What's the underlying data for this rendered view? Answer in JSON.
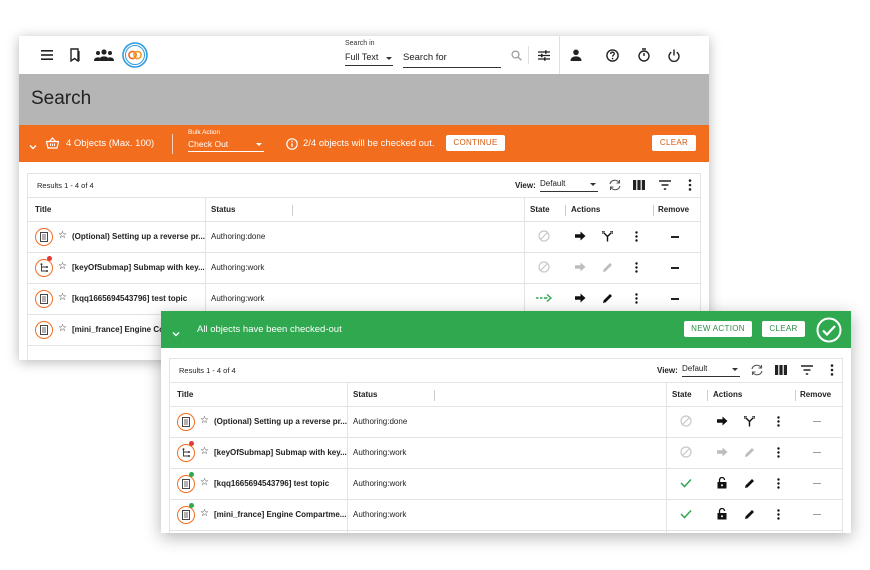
{
  "header": {
    "search_in_label": "Search in",
    "search_scope": "Full Text",
    "search_placeholder": "Search for"
  },
  "page": {
    "title": "Search"
  },
  "bulk_bar": {
    "objects_label": "4 Objects (Max. 100)",
    "bulk_action_label": "Bulk Action",
    "bulk_action_value": "Check Out",
    "warning": "2/4 objects will be checked out.",
    "continue_label": "CONTINUE",
    "clear_label": "CLEAR",
    "color": "#f36d1e"
  },
  "success_bar": {
    "message": "All objects have been checked-out",
    "new_action_label": "NEW ACTION",
    "clear_label": "CLEAR",
    "color": "#2fa84f"
  },
  "grid": {
    "results": "Results 1 - 4 of 4",
    "view_label": "View:",
    "view_value": "Default",
    "columns": {
      "title": "Title",
      "status": "Status",
      "state": "State",
      "actions": "Actions",
      "remove": "Remove"
    }
  },
  "rows_before": [
    {
      "title": "(Optional) Setting up a reverse pr...",
      "status": "Authoring:done",
      "state": "blocked-icon",
      "icon": "document-icon"
    },
    {
      "title": "[keyOfSubmap] Submap with key...",
      "status": "Authoring:work",
      "state": "blocked-icon",
      "icon": "map-icon"
    },
    {
      "title": "[kqq1665694543796] test topic",
      "status": "Authoring:work",
      "state": "dashed-arrow-icon",
      "icon": "document-icon"
    },
    {
      "title": "[mini_france] Engine Con",
      "status": "",
      "state": "",
      "icon": "document-icon"
    }
  ],
  "rows_after": [
    {
      "title": "(Optional) Setting up a reverse pr...",
      "status": "Authoring:done",
      "state": "blocked-icon"
    },
    {
      "title": "[keyOfSubmap] Submap with key...",
      "status": "Authoring:work",
      "state": "blocked-icon"
    },
    {
      "title": "[kqq1665694543796] test topic",
      "status": "Authoring:work",
      "state": "check-icon"
    },
    {
      "title": "[mini_france] Engine Compartme...",
      "status": "Authoring:work",
      "state": "check-icon"
    }
  ]
}
